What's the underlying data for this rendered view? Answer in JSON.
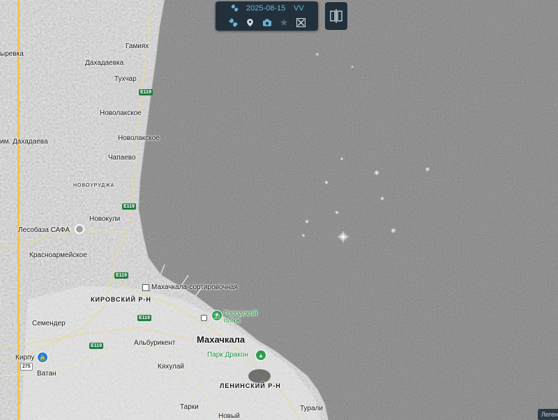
{
  "toolbar": {
    "date": "2025-08-15",
    "polarization": "VV",
    "icons": [
      "satellite-icon",
      "satellite-icon",
      "layers-pin-icon",
      "camera-icon",
      "star-icon",
      "compare-icon"
    ]
  },
  "colors": {
    "toolbar_bg": "#22303c",
    "accent": "#6fb6d8",
    "graticule": "#f2c14e",
    "road_green": "#1f7a3f",
    "poi_green": "#2e9e4f",
    "poi_blue": "#1e7fd6"
  },
  "legend_tab": "Леген",
  "places": {
    "gamiyakh": "Гамиях",
    "dakhadaevka": "Дахадаевка",
    "tukhchar": "Тухчар",
    "novolakskoe1": "Новолакское",
    "novolakskoe2": "Новолакское",
    "chapaevo": "Чапаево",
    "novokuli": "Новокули",
    "novouruzha": "НОВОУРУДЖА",
    "krasnoarmeyskoe": "Красноармейское",
    "semender": "Семендер",
    "albrikent": "Альбурикент",
    "kyakhulay": "Кяхулай",
    "tarki": "Тарки",
    "novy": "Новый",
    "turali": "Турали",
    "vatan": "Ватан",
    "karpu": "Кирпу",
    "left_label_1": "ыревка",
    "left_label_2": "им. Дахадаева",
    "makhachkala": "Махачкала",
    "kirovsky": "КИРОВСКИЙ Р-Н",
    "leninsky": "ЛЕНИНСКИЙ Р-Н",
    "lesobaza": "Лесобаза САФА",
    "station": "Махачкала-сортировочная",
    "beach": "Городской пляж",
    "park": "Парк Дракон"
  },
  "roads": {
    "e119_a": "E119",
    "e119_b": "E119",
    "e119_c": "E119",
    "e119_d": "E119",
    "e119_e": "E119",
    "r275": "275"
  }
}
